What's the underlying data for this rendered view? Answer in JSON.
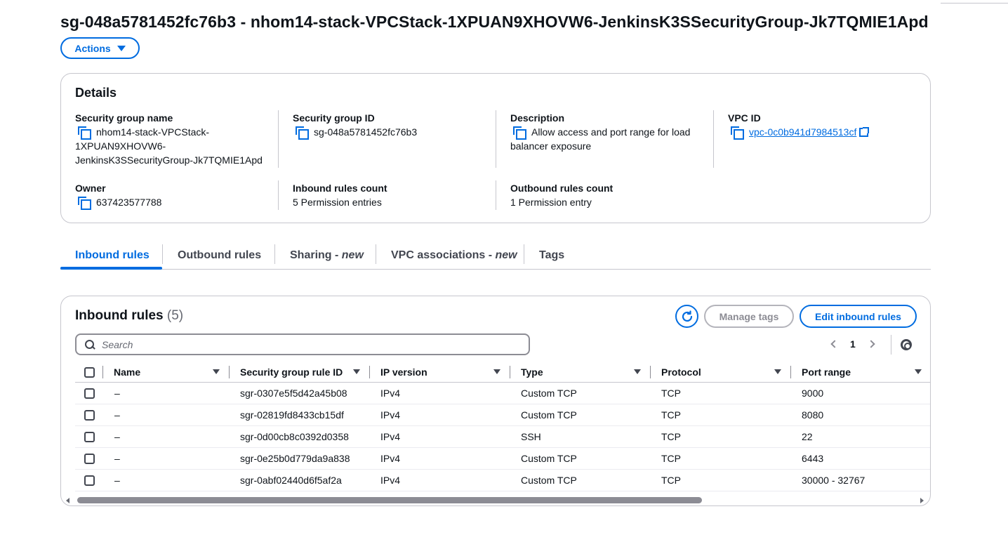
{
  "header": {
    "title": "sg-048a5781452fc76b3 - nhom14-stack-VPCStack-1XPUAN9XHOVW6-JenkinsK3SSecurityGroup-Jk7TQMIE1Apd",
    "actions_label": "Actions"
  },
  "details": {
    "heading": "Details",
    "sg_name_label": "Security group name",
    "sg_name_line1": "nhom14-stack-VPCStack-",
    "sg_name_line2": "1XPUAN9XHOVW6-",
    "sg_name_line3": "JenkinsK3SSecurityGroup-Jk7TQMIE1Apd",
    "sg_id_label": "Security group ID",
    "sg_id_value": "sg-048a5781452fc76b3",
    "description_label": "Description",
    "description_line1": "Allow access and port range for load",
    "description_line2": "balancer exposure",
    "vpc_id_label": "VPC ID",
    "vpc_id_value": "vpc-0c0b941d7984513cf",
    "owner_label": "Owner",
    "owner_value": "637423577788",
    "inbound_count_label": "Inbound rules count",
    "inbound_count_value": "5 Permission entries",
    "outbound_count_label": "Outbound rules count",
    "outbound_count_value": "1 Permission entry"
  },
  "tabs": [
    {
      "label": "Inbound rules",
      "suffix": ""
    },
    {
      "label": "Outbound rules",
      "suffix": ""
    },
    {
      "label": "Sharing - ",
      "suffix": "new"
    },
    {
      "label": "VPC associations - ",
      "suffix": "new"
    },
    {
      "label": "Tags",
      "suffix": ""
    }
  ],
  "inbound": {
    "title": "Inbound rules",
    "count": "(5)",
    "manage_tags_label": "Manage tags",
    "edit_label": "Edit inbound rules",
    "search_placeholder": "Search",
    "page": "1",
    "columns": [
      "Name",
      "Security group rule ID",
      "IP version",
      "Type",
      "Protocol",
      "Port range"
    ],
    "rows": [
      {
        "name": "–",
        "rule_id": "sgr-0307e5f5d42a45b08",
        "ip_version": "IPv4",
        "type": "Custom TCP",
        "protocol": "TCP",
        "port_range": "9000"
      },
      {
        "name": "–",
        "rule_id": "sgr-02819fd8433cb15df",
        "ip_version": "IPv4",
        "type": "Custom TCP",
        "protocol": "TCP",
        "port_range": "8080"
      },
      {
        "name": "–",
        "rule_id": "sgr-0d00cb8c0392d0358",
        "ip_version": "IPv4",
        "type": "SSH",
        "protocol": "TCP",
        "port_range": "22"
      },
      {
        "name": "–",
        "rule_id": "sgr-0e25b0d779da9a838",
        "ip_version": "IPv4",
        "type": "Custom TCP",
        "protocol": "TCP",
        "port_range": "6443"
      },
      {
        "name": "–",
        "rule_id": "sgr-0abf02440d6f5af2a",
        "ip_version": "IPv4",
        "type": "Custom TCP",
        "protocol": "TCP",
        "port_range": "30000 - 32767"
      }
    ]
  },
  "colors": {
    "accent": "#006ce0",
    "border": "#c6c6cd",
    "text": "#0f141a"
  }
}
